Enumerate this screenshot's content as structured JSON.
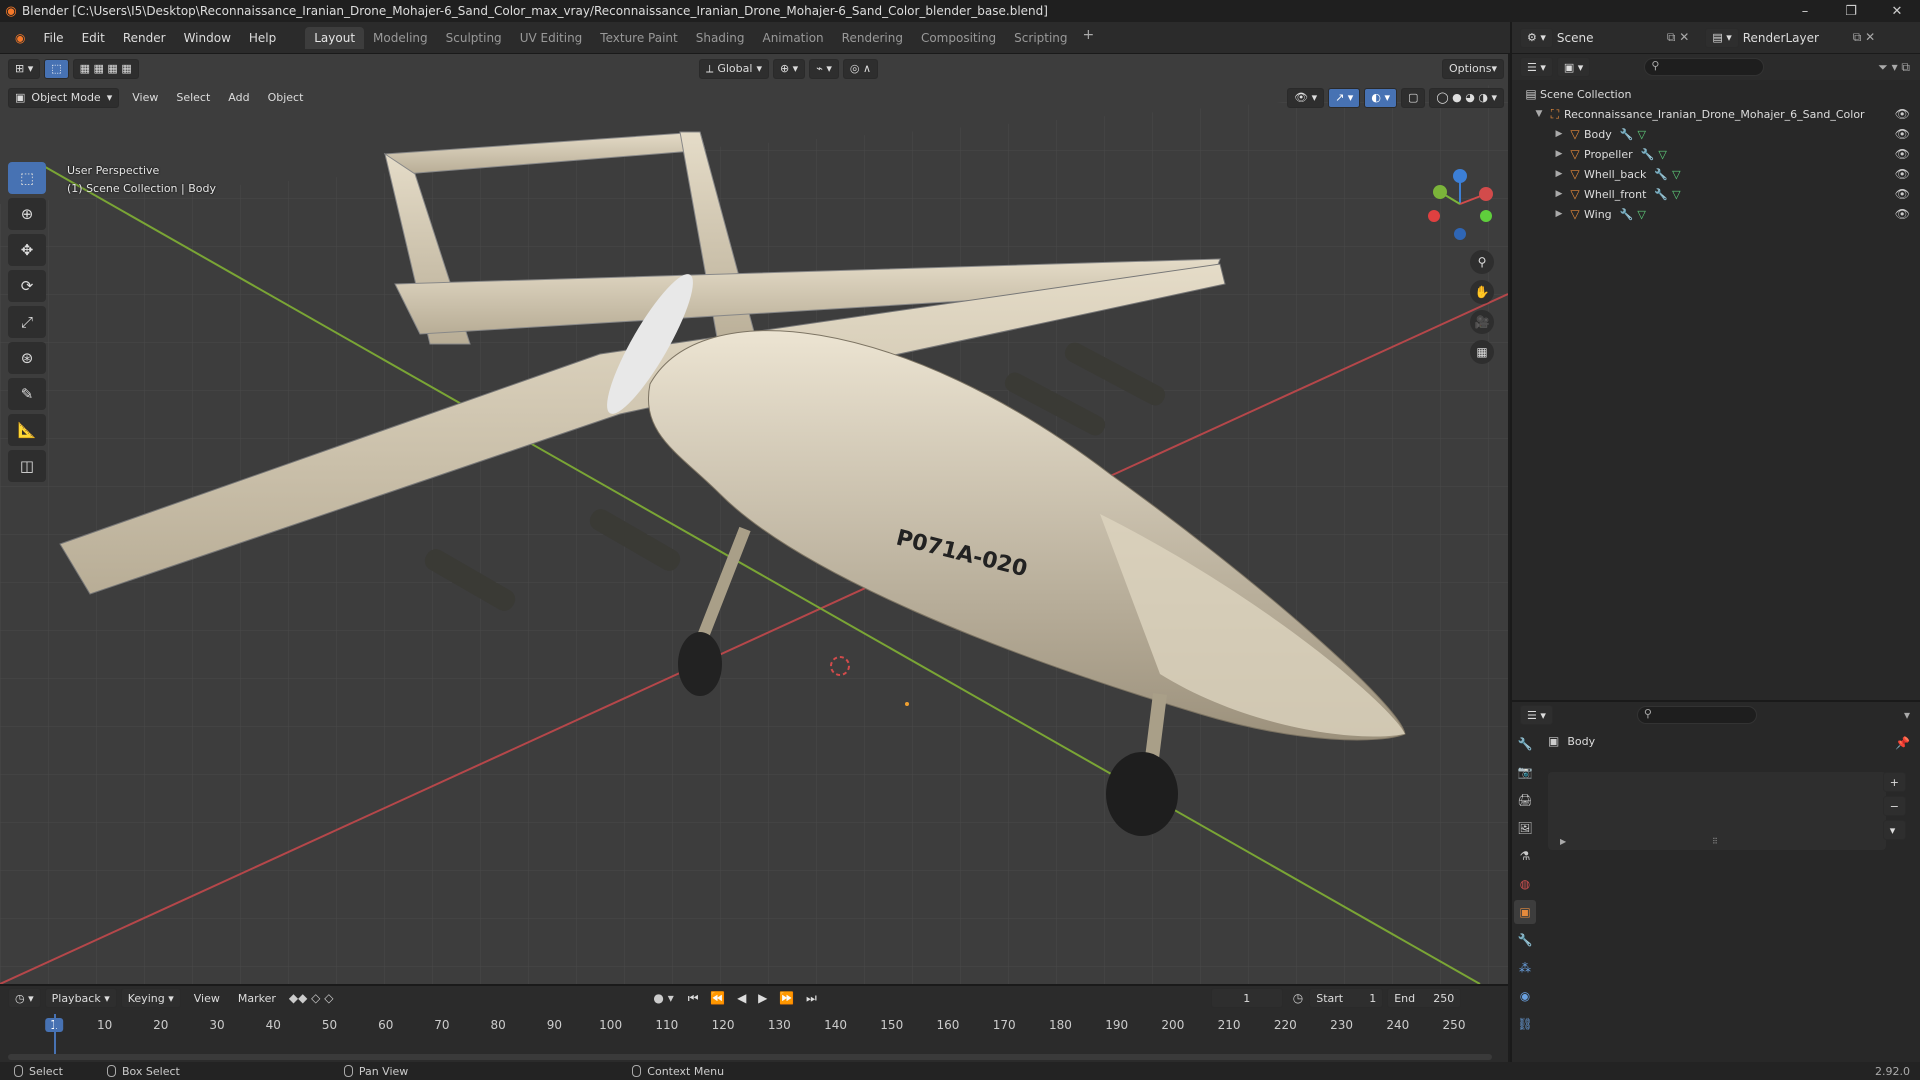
{
  "window": {
    "title": "Blender [C:\\Users\\I5\\Desktop\\Reconnaissance_Iranian_Drone_Mohajer-6_Sand_Color_max_vray/Reconnaissance_Iranian_Drone_Mohajer-6_Sand_Color_blender_base.blend]",
    "controls": [
      "–",
      "❐",
      "✕"
    ]
  },
  "menu": [
    "File",
    "Edit",
    "Render",
    "Window",
    "Help"
  ],
  "workspaces": [
    "Layout",
    "Modeling",
    "Sculpting",
    "UV Editing",
    "Texture Paint",
    "Shading",
    "Animation",
    "Rendering",
    "Compositing",
    "Scripting"
  ],
  "active_workspace": "Layout",
  "scene": {
    "label": "Scene",
    "render_layer": "RenderLayer"
  },
  "viewport": {
    "mode": "Object Mode",
    "menus": [
      "View",
      "Select",
      "Add",
      "Object"
    ],
    "transform": "Global",
    "options": "Options",
    "perspective": "User Perspective",
    "collection_info": "(1) Scene Collection | Body",
    "drone_label": "P071A-020"
  },
  "tools": [
    "select-box",
    "cursor",
    "move",
    "rotate",
    "scale",
    "transform",
    "annotate",
    "measure",
    "add-cube"
  ],
  "outliner": {
    "root": "Scene Collection",
    "collection": "Reconnaissance_Iranian_Drone_Mohajer_6_Sand_Color",
    "objects": [
      "Body",
      "Propeller",
      "Whell_back",
      "Whell_front",
      "Wing"
    ]
  },
  "properties": {
    "object_name": "Body"
  },
  "timeline": {
    "menus": [
      "Playback",
      "Keying",
      "View",
      "Marker"
    ],
    "current_frame": "1",
    "start_label": "Start",
    "start": "1",
    "end_label": "End",
    "end": "250",
    "ticks": [
      "1",
      "10",
      "20",
      "30",
      "40",
      "50",
      "60",
      "70",
      "80",
      "90",
      "100",
      "110",
      "120",
      "130",
      "140",
      "150",
      "160",
      "170",
      "180",
      "190",
      "200",
      "210",
      "220",
      "230",
      "240",
      "250"
    ]
  },
  "statusbar": {
    "select": "Select",
    "box_select": "Box Select",
    "pan_view": "Pan View",
    "context_menu": "Context Menu",
    "version": "2.92.0"
  },
  "colors": {
    "accent": "#4772b3",
    "x_axis": "#d24b4b",
    "y_axis": "#7bb43a",
    "z_axis": "#3c7fd6",
    "drone": "#cfc3a8"
  }
}
